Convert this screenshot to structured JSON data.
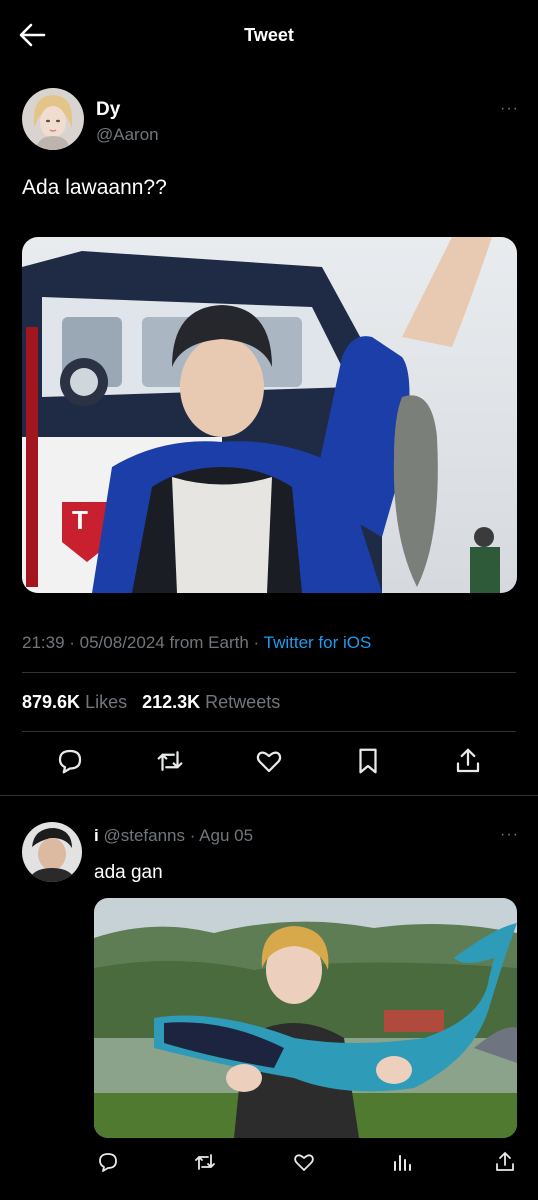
{
  "header": {
    "title": "Tweet",
    "back_icon": "arrow-left-icon"
  },
  "tweet": {
    "author_name": "Dy",
    "author_handle": "@Aaron",
    "text": "Ada lawaann??",
    "timestamp": "21:39 · 05/08/2024 from Earth · ",
    "source": "Twitter for iOS",
    "likes_count": "879.6K",
    "likes_label": "Likes",
    "retweets_count": "212.3K",
    "retweets_label": "Retweets"
  },
  "reply": {
    "author_name": "i",
    "author_handle": "@stefanns",
    "date": "· Agu 05",
    "text": "ada gan"
  },
  "colors": {
    "background": "#000000",
    "text": "#e7e9ea",
    "secondary": "#71767b",
    "link": "#1d9bf0",
    "divider": "#2f3336"
  },
  "icons": [
    "arrow-left-icon",
    "more-icon",
    "reply-icon",
    "retweet-icon",
    "like-icon",
    "bookmark-icon",
    "share-icon",
    "views-icon"
  ]
}
